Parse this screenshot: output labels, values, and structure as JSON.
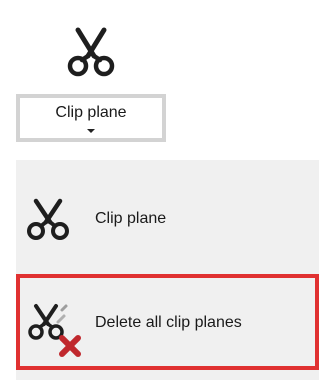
{
  "ribbon": {
    "button_label": "Clip plane",
    "icon": "scissors-icon"
  },
  "menu": {
    "items": [
      {
        "label": "Clip plane",
        "icon": "scissors-icon"
      },
      {
        "label": "Delete all clip planes",
        "icon": "delete-scissors-icon"
      }
    ]
  },
  "colors": {
    "highlight_border": "#e03131",
    "delete_x": "#c0282d",
    "menu_background": "#f0f0f0"
  }
}
